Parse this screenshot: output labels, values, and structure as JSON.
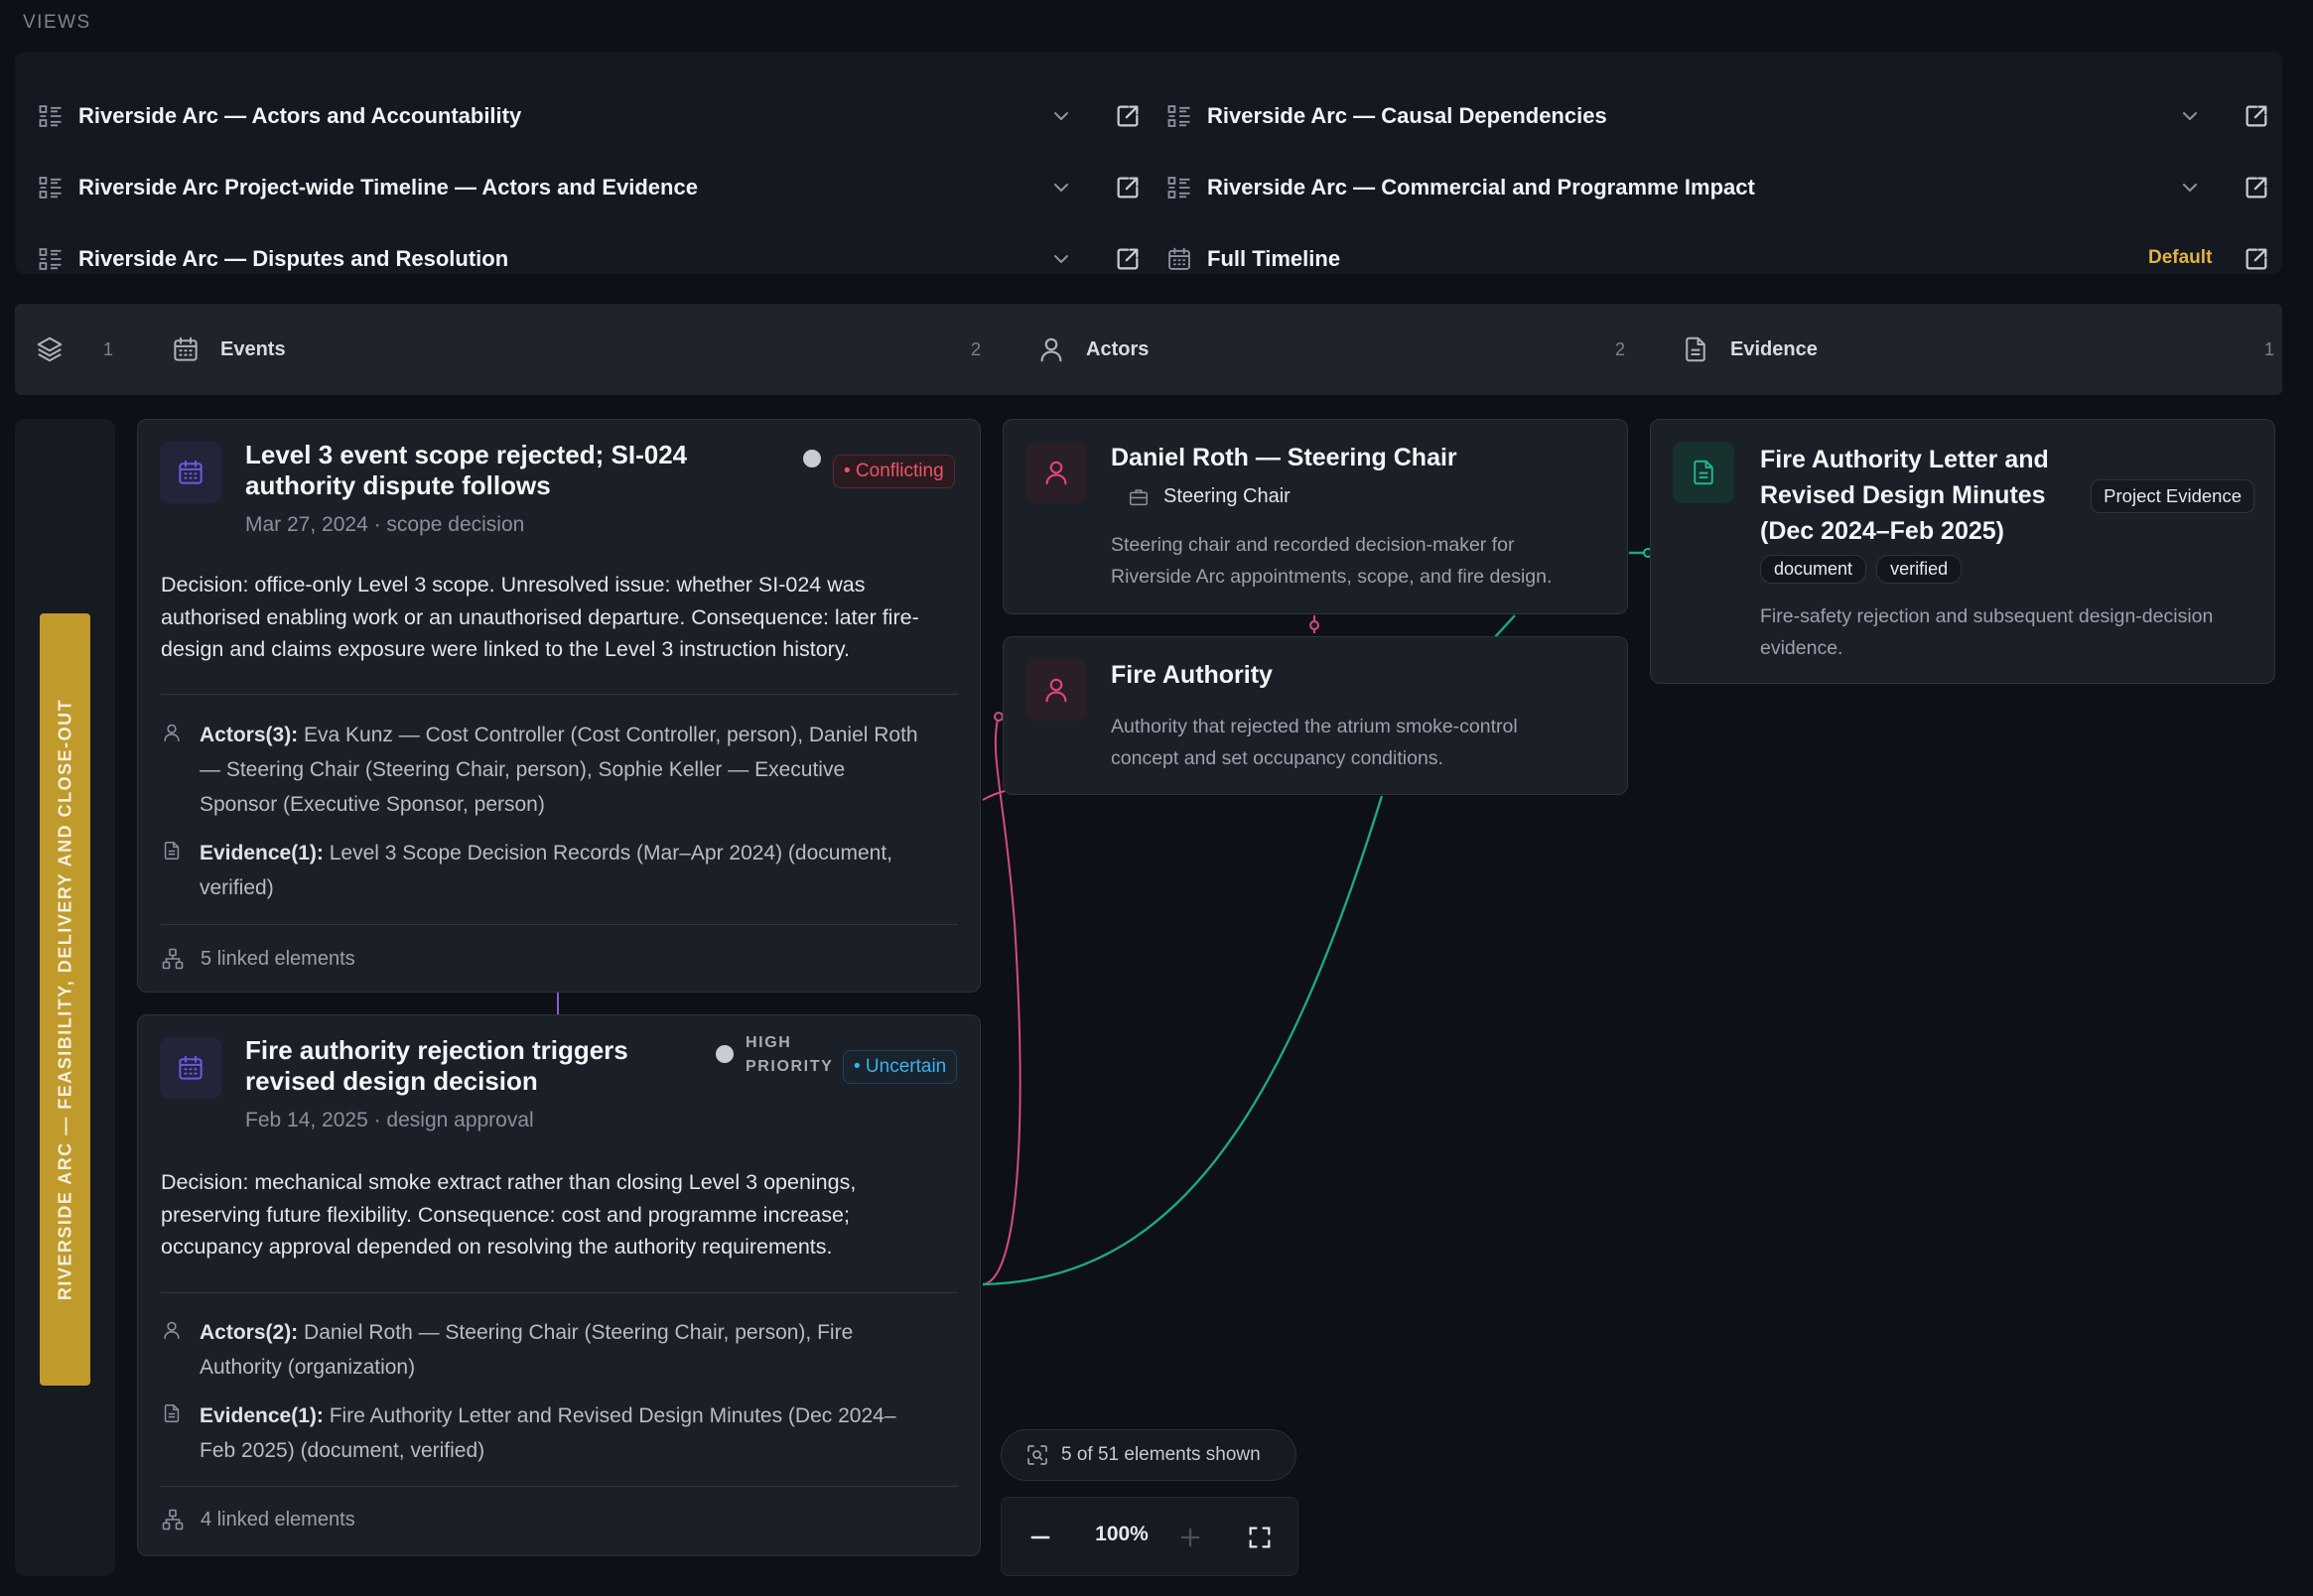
{
  "views": {
    "label": "VIEWS",
    "items": [
      {
        "title": "Riverside Arc — Actors and Accountability",
        "icon": "list-view-icon"
      },
      {
        "title": "Riverside Arc — Causal Dependencies",
        "icon": "list-view-icon"
      },
      {
        "title": "Riverside Arc Project-wide Timeline — Actors and Evidence",
        "icon": "list-view-icon"
      },
      {
        "title": "Riverside Arc — Commercial and Programme Impact",
        "icon": "list-view-icon"
      },
      {
        "title": "Riverside Arc — Disputes and Resolution",
        "icon": "list-view-icon"
      },
      {
        "title": "Full Timeline",
        "icon": "calendar-icon",
        "badge": "Default"
      }
    ]
  },
  "lanes": {
    "group_count": "1",
    "events": {
      "label": "Events",
      "count": "2"
    },
    "actors": {
      "label": "Actors",
      "count": "2"
    },
    "evidence": {
      "label": "Evidence",
      "count": "1"
    }
  },
  "sidebar": {
    "arc_label": "RIVERSIDE ARC — FEASIBILITY, DELIVERY AND CLOSE-OUT"
  },
  "events": [
    {
      "title_line1": "Level 3 event scope rejected; SI-024",
      "title_line2": "authority dispute follows",
      "date": "Mar 27, 2024 · scope decision",
      "status": "• Conflicting",
      "description_lines": [
        "Decision: office-only Level 3 scope. Unresolved issue: whether SI-024 was",
        "authorised enabling work or an unauthorised departure. Consequence: later fire-",
        "design and claims exposure were linked to the Level 3 instruction history."
      ],
      "actors_label": "Actors(3):",
      "actors_lines": [
        " Eva Kunz — Cost Controller (Cost Controller, person), Daniel Roth",
        "— Steering Chair (Steering Chair, person), Sophie Keller — Executive",
        "Sponsor (Executive Sponsor, person)"
      ],
      "evidence_label": "Evidence(1):",
      "evidence_lines": [
        " Level 3 Scope Decision Records (Mar–Apr 2024) (document,",
        "verified)"
      ],
      "linked": "5 linked elements"
    },
    {
      "title_line1": "Fire authority rejection triggers",
      "title_line2": "revised design decision",
      "date": "Feb 14, 2025 · design approval",
      "priority_line1": "HIGH",
      "priority_line2": "PRIORITY",
      "status": "• Uncertain",
      "description_lines": [
        "Decision: mechanical smoke extract rather than closing Level 3 openings,",
        "preserving future flexibility. Consequence: cost and programme increase;",
        "occupancy approval depended on resolving the authority requirements."
      ],
      "actors_label": "Actors(2):",
      "actors_lines": [
        " Daniel Roth — Steering Chair (Steering Chair, person), Fire",
        "Authority (organization)"
      ],
      "evidence_label": "Evidence(1):",
      "evidence_lines": [
        " Fire Authority Letter and Revised Design Minutes (Dec 2024–",
        "Feb 2025) (document, verified)"
      ],
      "linked": "4 linked elements"
    }
  ],
  "actors": [
    {
      "name": "Daniel Roth — Steering Chair",
      "role": "Steering Chair",
      "description_lines": [
        "Steering chair and recorded decision-maker for",
        "Riverside Arc appointments, scope, and fire design."
      ]
    },
    {
      "name": "Fire Authority",
      "description_lines": [
        "Authority that rejected the atrium smoke-control",
        "concept and set occupancy conditions."
      ]
    }
  ],
  "evidence": [
    {
      "title_lines": [
        "Fire Authority Letter and",
        "Revised Design Minutes",
        "(Dec 2024–Feb 2025)"
      ],
      "category": "Project Evidence",
      "tags": [
        "document",
        "verified"
      ],
      "description_lines": [
        "Fire-safety rejection and subsequent design-decision",
        "evidence."
      ]
    }
  ],
  "canvas": {
    "shown": "5 of 51 elements shown",
    "zoom": "100%"
  },
  "colors": {
    "background": "#0d1016",
    "card": "#1b2028",
    "event_accent": "#6a5ae0",
    "actor_accent": "#e0457b",
    "evidence_accent": "#1fb592",
    "arc_yellow": "#c09a2b",
    "default_badge": "#e3b341",
    "conflicting": "#f05265",
    "uncertain": "#3ab0f0"
  }
}
